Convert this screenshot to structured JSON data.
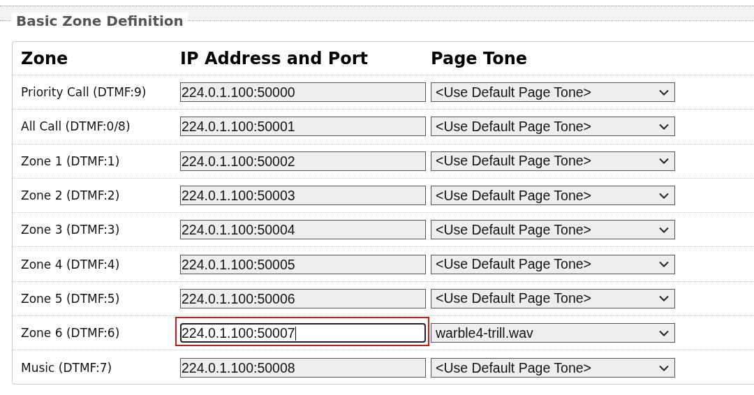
{
  "section": {
    "title": "Basic Zone Definition"
  },
  "table": {
    "columns": [
      "Zone",
      "IP Address and Port",
      "Page Tone"
    ],
    "rows": [
      {
        "zone": "Priority Call (DTMF:9)",
        "address": "224.0.1.100:50000",
        "tone": "<Use Default Page Tone>",
        "focused": false
      },
      {
        "zone": "All Call (DTMF:0/8)",
        "address": "224.0.1.100:50001",
        "tone": "<Use Default Page Tone>",
        "focused": false
      },
      {
        "zone": "Zone 1 (DTMF:1)",
        "address": "224.0.1.100:50002",
        "tone": "<Use Default Page Tone>",
        "focused": false
      },
      {
        "zone": "Zone 2 (DTMF:2)",
        "address": "224.0.1.100:50003",
        "tone": "<Use Default Page Tone>",
        "focused": false
      },
      {
        "zone": "Zone 3 (DTMF:3)",
        "address": "224.0.1.100:50004",
        "tone": "<Use Default Page Tone>",
        "focused": false
      },
      {
        "zone": "Zone 4 (DTMF:4)",
        "address": "224.0.1.100:50005",
        "tone": "<Use Default Page Tone>",
        "focused": false
      },
      {
        "zone": "Zone 5 (DTMF:5)",
        "address": "224.0.1.100:50006",
        "tone": "<Use Default Page Tone>",
        "focused": false
      },
      {
        "zone": "Zone 6 (DTMF:6)",
        "address": "224.0.1.100:50007",
        "tone": "warble4-trill.wav",
        "focused": true
      },
      {
        "zone": "Music (DTMF:7)",
        "address": "224.0.1.100:50008",
        "tone": "<Use Default Page Tone>",
        "focused": false
      }
    ]
  }
}
